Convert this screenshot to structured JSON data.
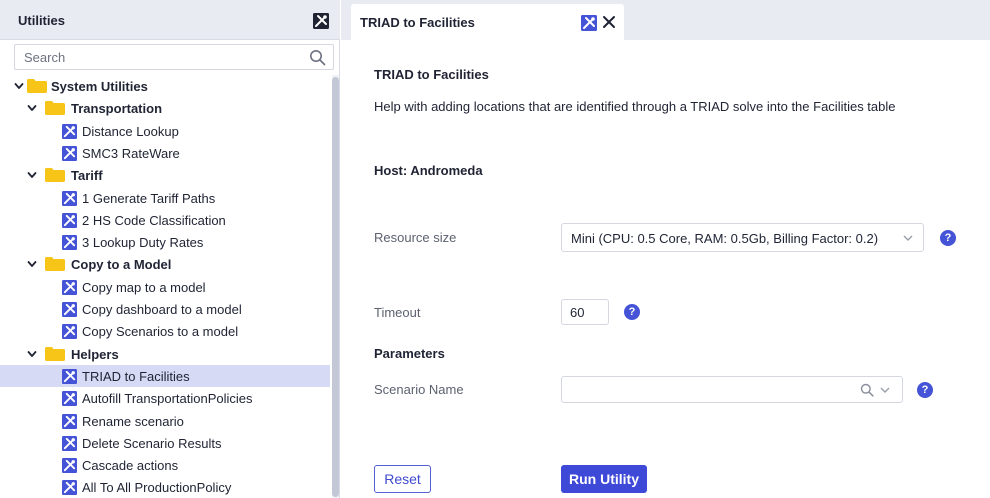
{
  "left_panel": {
    "title": "Utilities",
    "search_placeholder": "Search",
    "tree": [
      {
        "kind": "folder",
        "label": "System Utilities",
        "level": 0
      },
      {
        "kind": "folder",
        "label": "Transportation",
        "level": 1
      },
      {
        "kind": "utility",
        "label": "Distance Lookup"
      },
      {
        "kind": "utility",
        "label": "SMC3 RateWare"
      },
      {
        "kind": "folder",
        "label": "Tariff",
        "level": 1
      },
      {
        "kind": "utility",
        "label": "1 Generate Tariff Paths"
      },
      {
        "kind": "utility",
        "label": "2 HS Code Classification"
      },
      {
        "kind": "utility",
        "label": "3 Lookup Duty Rates"
      },
      {
        "kind": "folder",
        "label": "Copy to a Model",
        "level": 1
      },
      {
        "kind": "utility",
        "label": "Copy map to a model"
      },
      {
        "kind": "utility",
        "label": "Copy dashboard to a model"
      },
      {
        "kind": "utility",
        "label": "Copy Scenarios to a model"
      },
      {
        "kind": "folder",
        "label": "Helpers",
        "level": 1
      },
      {
        "kind": "utility",
        "label": "TRIAD to Facilities",
        "selected": true
      },
      {
        "kind": "utility",
        "label": "Autofill TransportationPolicies"
      },
      {
        "kind": "utility",
        "label": "Rename scenario"
      },
      {
        "kind": "utility",
        "label": "Delete Scenario Results"
      },
      {
        "kind": "utility",
        "label": "Cascade actions"
      },
      {
        "kind": "utility",
        "label": "All To All ProductionPolicy"
      }
    ]
  },
  "tab": {
    "label": "TRIAD to Facilities",
    "close_glyph": "✕"
  },
  "content": {
    "title": "TRIAD to Facilities",
    "description": "Help with adding locations that are identified through a TRIAD solve into the Facilities table",
    "host": "Host: Andromeda",
    "resource_size": {
      "label": "Resource size",
      "value": "Mini (CPU: 0.5 Core, RAM: 0.5Gb, Billing Factor: 0.2)"
    },
    "timeout": {
      "label": "Timeout",
      "value": "60"
    },
    "parameters_heading": "Parameters",
    "scenario_name": {
      "label": "Scenario Name",
      "value": ""
    },
    "help_glyph": "?",
    "reset_label": "Reset",
    "run_label": "Run Utility"
  },
  "colors": {
    "accent": "#3f49d8",
    "folder": "#f7c518",
    "selected_row": "#d6daf5",
    "utility_icon": "#4553d6",
    "header_bg": "#e9ebf3"
  }
}
